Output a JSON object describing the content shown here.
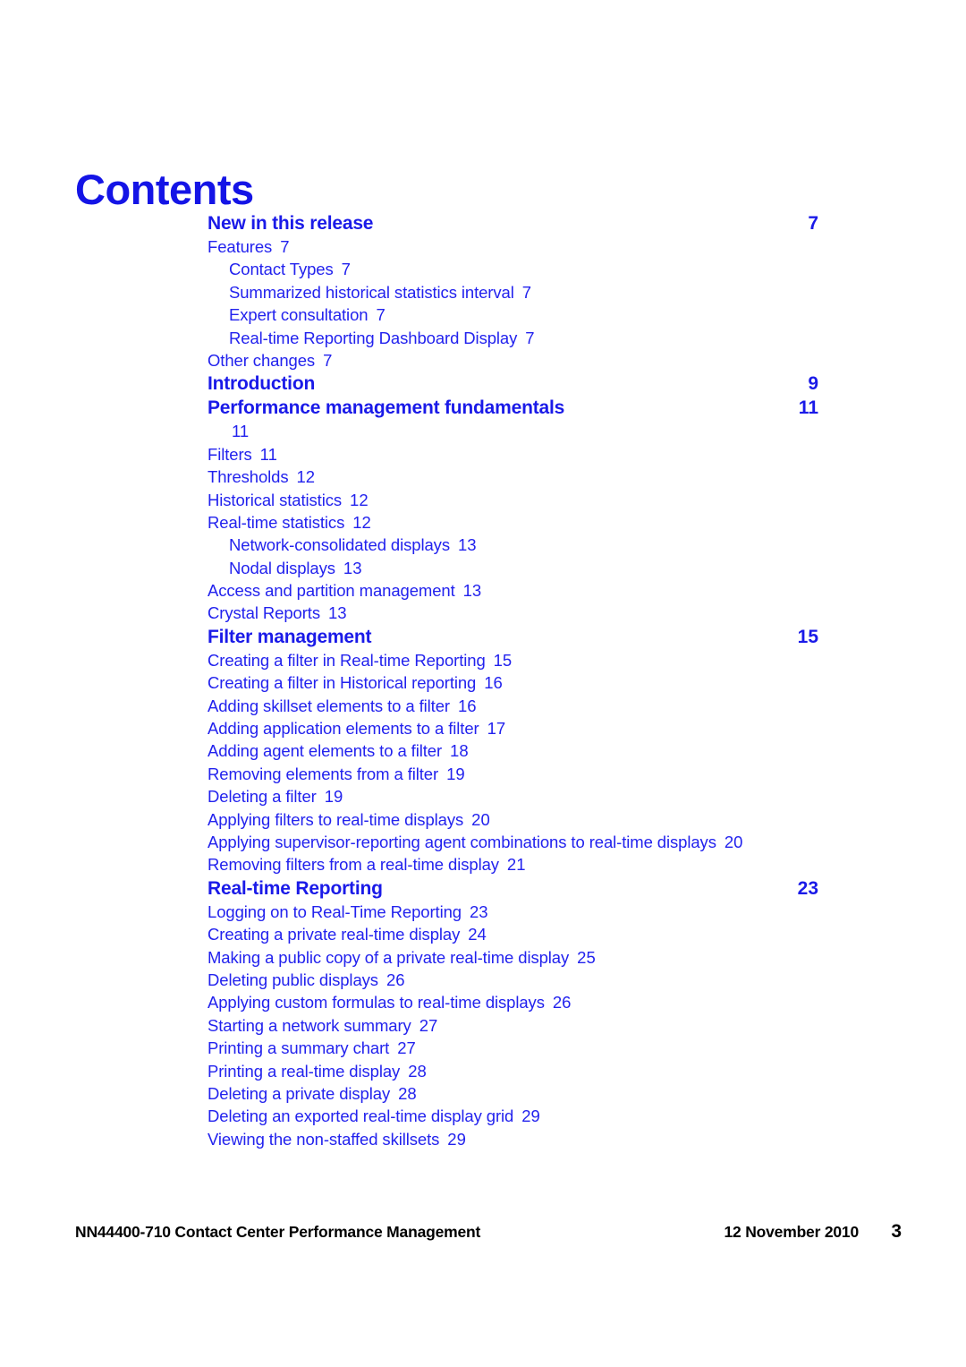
{
  "document": {
    "title": "Contents"
  },
  "toc": {
    "rows": [
      {
        "kind": "heading",
        "level": 1,
        "label": "New in this release",
        "page": "7"
      },
      {
        "kind": "entry",
        "level": 1,
        "label": "Features",
        "page": "7"
      },
      {
        "kind": "entry",
        "level": 2,
        "label": "Contact Types",
        "page": "7"
      },
      {
        "kind": "entry",
        "level": 2,
        "label": "Summarized historical statistics interval",
        "page": "7"
      },
      {
        "kind": "entry",
        "level": 2,
        "label": "Expert consultation",
        "page": "7"
      },
      {
        "kind": "entry",
        "level": 2,
        "label": "Real-time Reporting Dashboard Display",
        "page": "7"
      },
      {
        "kind": "entry",
        "level": 1,
        "label": "Other changes",
        "page": "7"
      },
      {
        "kind": "heading",
        "level": 1,
        "label": "Introduction",
        "page": "9"
      },
      {
        "kind": "heading",
        "level": 1,
        "label": "Performance management fundamentals",
        "page": "11"
      },
      {
        "kind": "orphan",
        "level": 1,
        "label": "",
        "page": "11"
      },
      {
        "kind": "entry",
        "level": 1,
        "label": "Filters",
        "page": "11"
      },
      {
        "kind": "entry",
        "level": 1,
        "label": "Thresholds",
        "page": "12"
      },
      {
        "kind": "entry",
        "level": 1,
        "label": "Historical statistics",
        "page": "12"
      },
      {
        "kind": "entry",
        "level": 1,
        "label": "Real-time statistics",
        "page": "12"
      },
      {
        "kind": "entry",
        "level": 2,
        "label": "Network-consolidated displays",
        "page": "13"
      },
      {
        "kind": "entry",
        "level": 2,
        "label": "Nodal displays",
        "page": "13"
      },
      {
        "kind": "entry",
        "level": 1,
        "label": "Access and partition management",
        "page": "13"
      },
      {
        "kind": "entry",
        "level": 1,
        "label": "Crystal Reports",
        "page": "13"
      },
      {
        "kind": "heading",
        "level": 1,
        "label": "Filter management",
        "page": "15"
      },
      {
        "kind": "entry",
        "level": 1,
        "label": "Creating a filter in Real-time Reporting",
        "page": "15"
      },
      {
        "kind": "entry",
        "level": 1,
        "label": "Creating a filter in Historical reporting",
        "page": "16"
      },
      {
        "kind": "entry",
        "level": 1,
        "label": "Adding skillset elements to a filter",
        "page": "16"
      },
      {
        "kind": "entry",
        "level": 1,
        "label": "Adding application elements to a filter",
        "page": "17"
      },
      {
        "kind": "entry",
        "level": 1,
        "label": "Adding agent elements to a filter",
        "page": "18"
      },
      {
        "kind": "entry",
        "level": 1,
        "label": "Removing elements from a filter",
        "page": "19"
      },
      {
        "kind": "entry",
        "level": 1,
        "label": "Deleting a filter",
        "page": "19"
      },
      {
        "kind": "entry",
        "level": 1,
        "label": "Applying filters to real-time displays",
        "page": "20"
      },
      {
        "kind": "entry",
        "level": 1,
        "label": "Applying supervisor-reporting agent combinations to real-time displays",
        "page": "20"
      },
      {
        "kind": "entry",
        "level": 1,
        "label": "Removing filters from a real-time display",
        "page": "21"
      },
      {
        "kind": "heading",
        "level": 1,
        "label": "Real-time Reporting",
        "page": "23"
      },
      {
        "kind": "entry",
        "level": 1,
        "label": "Logging on to Real-Time Reporting",
        "page": "23"
      },
      {
        "kind": "entry",
        "level": 1,
        "label": "Creating a private real-time display",
        "page": "24"
      },
      {
        "kind": "entry",
        "level": 1,
        "label": "Making a public copy of a private real-time display",
        "page": "25"
      },
      {
        "kind": "entry",
        "level": 1,
        "label": "Deleting public displays",
        "page": "26"
      },
      {
        "kind": "entry",
        "level": 1,
        "label": "Applying custom formulas to real-time displays",
        "page": "26"
      },
      {
        "kind": "entry",
        "level": 1,
        "label": "Starting a network summary",
        "page": "27"
      },
      {
        "kind": "entry",
        "level": 1,
        "label": "Printing a summary chart",
        "page": "27"
      },
      {
        "kind": "entry",
        "level": 1,
        "label": "Printing a real-time display",
        "page": "28"
      },
      {
        "kind": "entry",
        "level": 1,
        "label": "Deleting a private display",
        "page": "28"
      },
      {
        "kind": "entry",
        "level": 1,
        "label": "Deleting an exported real-time display grid",
        "page": "29"
      },
      {
        "kind": "entry",
        "level": 1,
        "label": "Viewing the non-staffed skillsets",
        "page": "29"
      }
    ]
  },
  "footer": {
    "left": "NN44400-710 Contact Center Performance Management",
    "date": "12 November 2010",
    "page_number": "3"
  },
  "colors": {
    "link_blue": "#2222ee",
    "heading_blue": "#1a1ae8",
    "title_blue": "#1414e6",
    "footer_black": "#000000",
    "background": "#ffffff"
  }
}
